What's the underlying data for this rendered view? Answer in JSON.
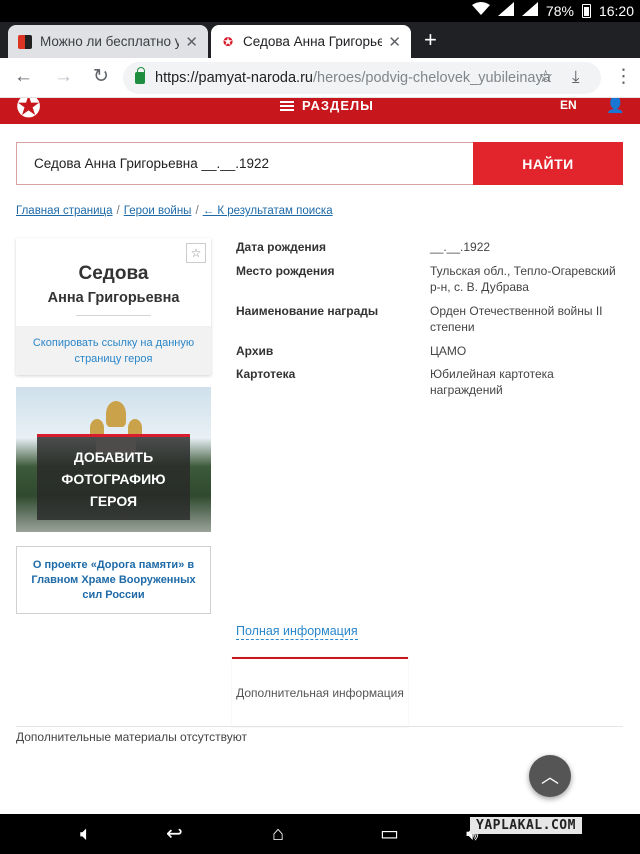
{
  "status_bar": {
    "battery": "78%",
    "time": "16:20"
  },
  "browser": {
    "tabs": [
      {
        "title": "Можно ли бесплатно узнат",
        "active": false
      },
      {
        "title": "Седова Анна Григорьевна",
        "active": true
      }
    ],
    "new_tab_glyph": "+",
    "url_domain": "https://pamyat-naroda.ru",
    "url_path": "/heroes/podvig-chelovek_yubileinaya"
  },
  "site": {
    "menu_label": "РАЗДЕЛЫ",
    "lang": "EN"
  },
  "search": {
    "value": "Седова Анна Григорьевна __.__.1922",
    "button_label": "НАЙТИ"
  },
  "breadcrumb": {
    "home": "Главная страница",
    "sep1": "/",
    "heroes": "Герои войны",
    "sep2": "/",
    "back": "← К результатам поиска"
  },
  "hero": {
    "surname": "Седова",
    "names": "Анна Григорьевна",
    "copy_link": "Скопировать ссылку на данную страницу героя",
    "photo_cta": "ДОБАВИТЬ ФОТОГРАФИЮ ГЕРОЯ",
    "about": "О проекте «Дорога памяти» в Главном Храме Вооруженных сил России"
  },
  "info": [
    {
      "label": "Дата рождения",
      "value": "__.__.1922"
    },
    {
      "label": "Место рождения",
      "value": "Тульская обл., Тепло-Огаревский р-н, с. В. Дубрава"
    },
    {
      "label": "Наименование награды",
      "value": "Орден Отечественной войны II степени"
    },
    {
      "label": "Архив",
      "value": "ЦАМО"
    },
    {
      "label": "Картотека",
      "value": "Юбилейная картотека награждений"
    }
  ],
  "full_info_link": "Полная информация",
  "additional_tab": "Дополнительная информация",
  "no_materials": "Дополнительные материалы отсутствуют",
  "watermark": "YAPLAKAL.COM",
  "colors": {
    "brand_red": "#c8161d",
    "button_red": "#e2242d",
    "link_blue": "#2a86c9"
  },
  "icons": [
    "wifi-icon",
    "signal-icon",
    "battery-icon",
    "back-icon",
    "forward-icon",
    "reload-icon",
    "lock-icon",
    "bookmark-star-icon",
    "download-icon",
    "overflow-menu-icon",
    "star-logo-icon",
    "user-icon",
    "favorite-star-icon",
    "chevron-up-icon",
    "volume-down-icon",
    "nav-back-icon",
    "home-icon",
    "recents-icon",
    "volume-up-icon",
    "screenshot-icon"
  ]
}
